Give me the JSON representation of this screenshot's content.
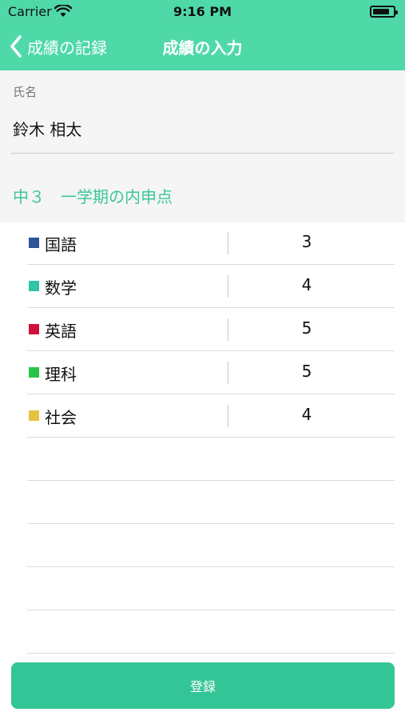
{
  "status_bar": {
    "carrier": "Carrier",
    "time": "9:16 PM"
  },
  "nav": {
    "back_label": "成績の記録",
    "title": "成績の入力"
  },
  "student": {
    "name_label": "氏名",
    "name_value": "鈴木 相太"
  },
  "section": {
    "title": "中３　一学期の内申点"
  },
  "subjects": [
    {
      "name": "国語",
      "score": "3",
      "color": "#2f5597"
    },
    {
      "name": "数学",
      "score": "4",
      "color": "#2ec4a4"
    },
    {
      "name": "英語",
      "score": "5",
      "color": "#d0103c"
    },
    {
      "name": "理科",
      "score": "5",
      "color": "#27c44a"
    },
    {
      "name": "社会",
      "score": "4",
      "color": "#e6c33e"
    }
  ],
  "submit_label": "登録",
  "colors": {
    "accent": "#4fd9a8",
    "button": "#34c597",
    "section_text": "#3cc895"
  }
}
